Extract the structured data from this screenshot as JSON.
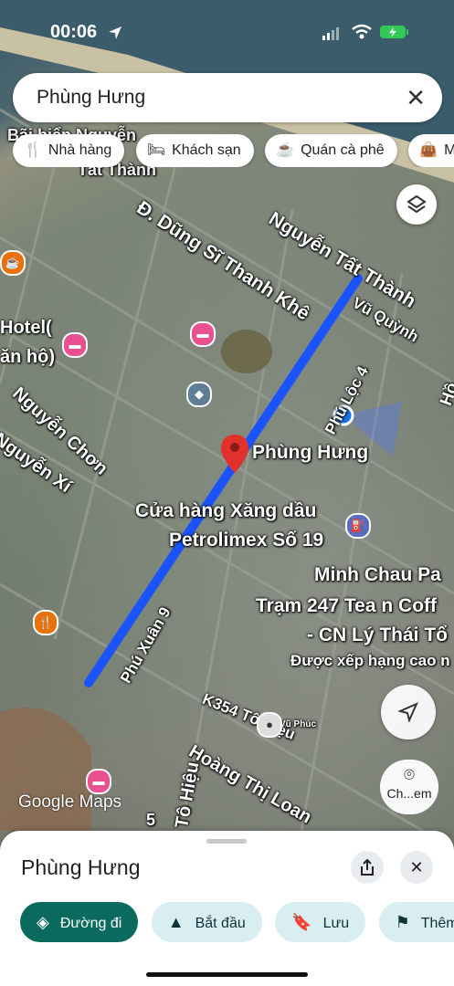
{
  "status": {
    "time": "00:06",
    "battery_color": "#34c759"
  },
  "search": {
    "query": "Phùng Hưng",
    "clear_icon": "close-icon"
  },
  "chips": [
    {
      "label": "Nhà hàng",
      "icon": "fork-knife-icon"
    },
    {
      "label": "Khách sạn",
      "icon": "bed-icon"
    },
    {
      "label": "Quán cà phê",
      "icon": "coffee-cup-icon"
    },
    {
      "label": "Mua",
      "icon": "shopping-bag-icon"
    }
  ],
  "map": {
    "route_color": "#1a53ff",
    "pin_color": "#e2312d",
    "labels": {
      "beach": "Bãi biển Nguyễn",
      "beach2": "Tất Thành",
      "nguyen_tat_thanh": "Nguyễn Tất Thành",
      "dung_si": "Đ. Dũng Sĩ Thanh Khê",
      "vu_quynh": "Vũ Quỳnh",
      "hotel": "Hotel(",
      "hotel2": "ăn hộ)",
      "nguyen_chon": "Nguyễn Chơn",
      "nguyen_xi": "Nguyễn Xí",
      "phu_loc": "Phú Lộc 4",
      "ho": "Hồ",
      "pin_label": "Phùng Hưng",
      "petrolimex1": "Cửa hàng Xăng dầu",
      "petrolimex2": "Petrolimex Số 19",
      "minh_chau": "Minh Chau Pa",
      "tram": "Trạm 247 Tea n Coff",
      "cn": "- CN Lý Thái Tổ",
      "rated": "Được xếp hạng cao n",
      "phu_xuan": "Phú Xuân 9",
      "k354": "K354 Tô Hiệu",
      "hoang_thi_loan": "Hoàng Thị Loan",
      "to_hieu": "Tô Hiệu",
      "five": "5",
      "profile": "Vũ Phúc"
    },
    "google_logo": "Google",
    "google_maps": "Maps"
  },
  "controls": {
    "layers_icon": "layers-icon",
    "navigate_icon": "location-arrow-icon",
    "lens_label": "Ch...em"
  },
  "sheet": {
    "title": "Phùng Hưng",
    "share_icon": "share-icon",
    "close_icon": "close-icon",
    "actions": [
      {
        "label": "Đường đi",
        "icon": "directions-icon",
        "style": "primary"
      },
      {
        "label": "Bắt đầu",
        "icon": "navigation-arrow-icon",
        "style": "sec"
      },
      {
        "label": "Lưu",
        "icon": "bookmark-icon",
        "style": "sec"
      },
      {
        "label": "Thêm",
        "icon": "flag-icon",
        "style": "sec"
      }
    ]
  }
}
